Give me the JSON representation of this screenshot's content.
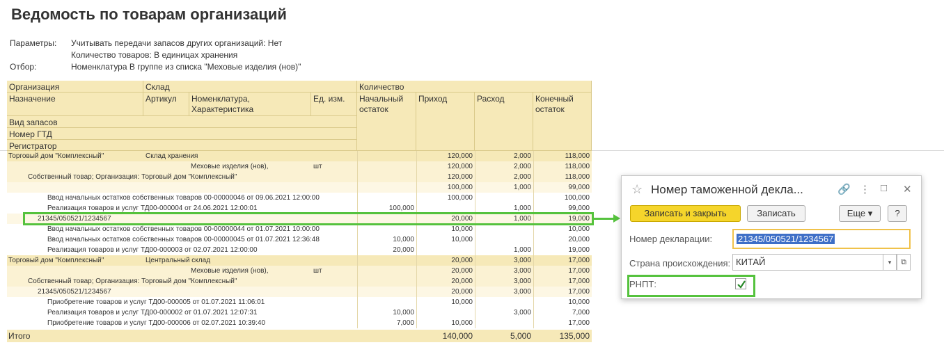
{
  "title": "Ведомость по товарам организаций",
  "params": [
    {
      "label": "Параметры:",
      "value": "Учитывать передачи запасов других организаций: Нет"
    },
    {
      "label": "",
      "value": "Количество товаров: В единицах хранения"
    },
    {
      "label": "Отбор:",
      "value": "Номенклатура В группе из списка \"Меховые изделия (нов)\""
    }
  ],
  "header": {
    "org": "Организация",
    "sklad": "Склад",
    "kolichestvo": "Количество",
    "naznachenie": "Назначение",
    "artikul": "Артикул",
    "nomenklatura": "Номенклатура, Характеристика",
    "ed": "Ед. изм.",
    "nach": "Начальный остаток",
    "prihod": "Приход",
    "rashod": "Расход",
    "kon": "Конечный остаток",
    "vid": "Вид запасов",
    "gtd": "Номер ГТД",
    "registrator": "Регистратор"
  },
  "rows": [
    {
      "style": "grp1",
      "indent": 0,
      "text": "Торговый дом \"Комплексный\"",
      "col2": "Склад хранения",
      "ed": "",
      "nach": "",
      "prihod": "120,000",
      "rashod": "2,000",
      "kon": "118,000"
    },
    {
      "style": "grp2",
      "indent": 0,
      "text": "",
      "col2": "Меховые изделия (нов),",
      "ed": "шт",
      "nach": "",
      "prihod": "120,000",
      "rashod": "2,000",
      "kon": "118,000"
    },
    {
      "style": "grp2",
      "indent": 28,
      "text": "Собственный товар; Организация: Торговый дом \"Комплексный\"",
      "col2": "",
      "ed": "",
      "nach": "",
      "prihod": "120,000",
      "rashod": "2,000",
      "kon": "118,000"
    },
    {
      "style": "grp3",
      "indent": 0,
      "text": "",
      "col2": "",
      "ed": "",
      "nach": "",
      "prihod": "100,000",
      "rashod": "1,000",
      "kon": "99,000"
    },
    {
      "style": "plain",
      "indent": 56,
      "text": "Ввод начальных остатков собственных товаров 00-00000046 от 09.06.2021 12:00:00",
      "col2": "",
      "ed": "",
      "nach": "",
      "prihod": "100,000",
      "rashod": "",
      "kon": "100,000"
    },
    {
      "style": "plain",
      "indent": 56,
      "text": "Реализация товаров и услуг ТД00-000004 от 24.06.2021 12:00:01",
      "col2": "",
      "ed": "",
      "nach": "100,000",
      "prihod": "",
      "rashod": "1,000",
      "kon": "99,000"
    },
    {
      "style": "grp3",
      "indent": 42,
      "text": "21345/050521/1234567",
      "col2": "",
      "ed": "",
      "nach": "",
      "prihod": "20,000",
      "rashod": "1,000",
      "kon": "19,000"
    },
    {
      "style": "plain",
      "indent": 56,
      "text": "Ввод начальных остатков собственных товаров 00-00000044 от 01.07.2021 10:00:00",
      "col2": "",
      "ed": "",
      "nach": "",
      "prihod": "10,000",
      "rashod": "",
      "kon": "10,000"
    },
    {
      "style": "plain",
      "indent": 56,
      "text": "Ввод начальных остатков собственных товаров 00-00000045 от 01.07.2021 12:36:48",
      "col2": "",
      "ed": "",
      "nach": "10,000",
      "prihod": "10,000",
      "rashod": "",
      "kon": "20,000"
    },
    {
      "style": "plain",
      "indent": 56,
      "text": "Реализация товаров и услуг ТД00-000003 от 02.07.2021 12:00:00",
      "col2": "",
      "ed": "",
      "nach": "20,000",
      "prihod": "",
      "rashod": "1,000",
      "kon": "19,000"
    },
    {
      "style": "grp1",
      "indent": 0,
      "text": "Торговый дом \"Комплексный\"",
      "col2": "Центральный склад",
      "ed": "",
      "nach": "",
      "prihod": "20,000",
      "rashod": "3,000",
      "kon": "17,000"
    },
    {
      "style": "grp2",
      "indent": 0,
      "text": "",
      "col2": "Меховые изделия (нов),",
      "ed": "шт",
      "nach": "",
      "prihod": "20,000",
      "rashod": "3,000",
      "kon": "17,000"
    },
    {
      "style": "grp2",
      "indent": 28,
      "text": "Собственный товар; Организация: Торговый дом \"Комплексный\"",
      "col2": "",
      "ed": "",
      "nach": "",
      "prihod": "20,000",
      "rashod": "3,000",
      "kon": "17,000"
    },
    {
      "style": "grp3",
      "indent": 42,
      "text": "21345/050521/1234567",
      "col2": "",
      "ed": "",
      "nach": "",
      "prihod": "20,000",
      "rashod": "3,000",
      "kon": "17,000"
    },
    {
      "style": "plain",
      "indent": 56,
      "text": "Приобретение товаров и услуг ТД00-000005 от 01.07.2021 11:06:01",
      "col2": "",
      "ed": "",
      "nach": "",
      "prihod": "10,000",
      "rashod": "",
      "kon": "10,000"
    },
    {
      "style": "plain",
      "indent": 56,
      "text": "Реализация товаров и услуг ТД00-000002 от 01.07.2021 12:07:31",
      "col2": "",
      "ed": "",
      "nach": "10,000",
      "prihod": "",
      "rashod": "3,000",
      "kon": "7,000"
    },
    {
      "style": "plain",
      "indent": 56,
      "text": "Приобретение товаров и услуг ТД00-000006 от 02.07.2021 10:39:40",
      "col2": "",
      "ed": "",
      "nach": "7,000",
      "prihod": "10,000",
      "rashod": "",
      "kon": "17,000"
    }
  ],
  "total": {
    "label": "Итого",
    "prihod": "140,000",
    "rashod": "5,000",
    "kon": "135,000"
  },
  "dialog": {
    "title": "Номер таможенной декла...",
    "save_close": "Записать и закрыть",
    "save": "Записать",
    "more": "Еще",
    "help": "?",
    "decl_label": "Номер декларации:",
    "decl_value": "21345/050521/1234567",
    "country_label": "Страна происхождения:",
    "country_value": "КИТАЙ",
    "rnpt_label": "РНПТ:",
    "rnpt_checked": true
  },
  "colors": {
    "highlight": "#55c23d",
    "header_bg": "#f6e9b8",
    "primary_button": "#f5d52b",
    "selection": "#3e6fc7"
  }
}
